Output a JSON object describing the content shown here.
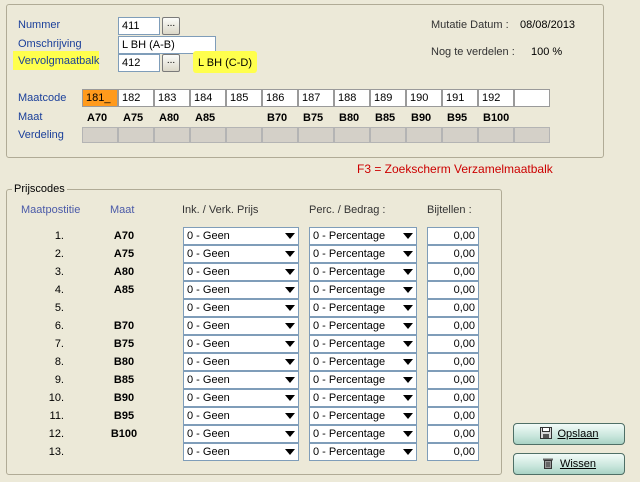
{
  "header": {
    "nummer_label": "Nummer",
    "nummer_value": "411",
    "omschrijving_label": "Omschrijving",
    "omschrijving_value": "L BH (A-B)",
    "vervolg_label": "Vervolgmaatbalk",
    "vervolg_value": "412",
    "vervolg_desc": "L BH (C-D)",
    "lookup_label": "...",
    "mutatie_label": "Mutatie Datum :",
    "mutatie_value": "08/08/2013",
    "nogte_label": "Nog te verdelen :",
    "nogte_value": "100 %"
  },
  "maatgrid": {
    "maatcode_label": "Maatcode",
    "maat_label": "Maat",
    "verdeling_label": "Verdeling",
    "codes": [
      "181_",
      "182",
      "183",
      "184",
      "185",
      "186",
      "187",
      "188",
      "189",
      "190",
      "191",
      "192",
      ""
    ],
    "maten": [
      "A70",
      "A75",
      "A80",
      "A85",
      "",
      "B70",
      "B75",
      "B80",
      "B85",
      "B90",
      "B95",
      "B100",
      ""
    ]
  },
  "note": "F3 = Zoekscherm Verzamelmaatbalk",
  "prijscodes": {
    "legend": "Prijscodes",
    "col_maatpostitie": "Maatpostitie",
    "col_maat": "Maat",
    "col_ink": "Ink. / Verk. Prijs",
    "col_perc": "Perc. / Bedrag :",
    "col_bijtellen": "Bijtellen :",
    "rows": [
      {
        "num": "1.",
        "maat": "A70",
        "ink": "0 - Geen",
        "perc": "0 - Percentage",
        "bij": "0,00"
      },
      {
        "num": "2.",
        "maat": "A75",
        "ink": "0 - Geen",
        "perc": "0 - Percentage",
        "bij": "0,00"
      },
      {
        "num": "3.",
        "maat": "A80",
        "ink": "0 - Geen",
        "perc": "0 - Percentage",
        "bij": "0,00"
      },
      {
        "num": "4.",
        "maat": "A85",
        "ink": "0 - Geen",
        "perc": "0 - Percentage",
        "bij": "0,00"
      },
      {
        "num": "5.",
        "maat": "",
        "ink": "0 - Geen",
        "perc": "0 - Percentage",
        "bij": "0,00"
      },
      {
        "num": "6.",
        "maat": "B70",
        "ink": "0 - Geen",
        "perc": "0 - Percentage",
        "bij": "0,00"
      },
      {
        "num": "7.",
        "maat": "B75",
        "ink": "0 - Geen",
        "perc": "0 - Percentage",
        "bij": "0,00"
      },
      {
        "num": "8.",
        "maat": "B80",
        "ink": "0 - Geen",
        "perc": "0 - Percentage",
        "bij": "0,00"
      },
      {
        "num": "9.",
        "maat": "B85",
        "ink": "0 - Geen",
        "perc": "0 - Percentage",
        "bij": "0,00"
      },
      {
        "num": "10.",
        "maat": "B90",
        "ink": "0 - Geen",
        "perc": "0 - Percentage",
        "bij": "0,00"
      },
      {
        "num": "11.",
        "maat": "B95",
        "ink": "0 - Geen",
        "perc": "0 - Percentage",
        "bij": "0,00"
      },
      {
        "num": "12.",
        "maat": "B100",
        "ink": "0 - Geen",
        "perc": "0 - Percentage",
        "bij": "0,00"
      },
      {
        "num": "13.",
        "maat": "",
        "ink": "0 - Geen",
        "perc": "0 - Percentage",
        "bij": "0,00"
      }
    ]
  },
  "buttons": {
    "opslaan": "Opslaan",
    "wissen": "Wissen"
  },
  "colors": {
    "highlight": "#ffff4d",
    "active_cell": "#ff9a1c",
    "note_red": "#cc0000",
    "label_blue": "#1a3f9a"
  }
}
